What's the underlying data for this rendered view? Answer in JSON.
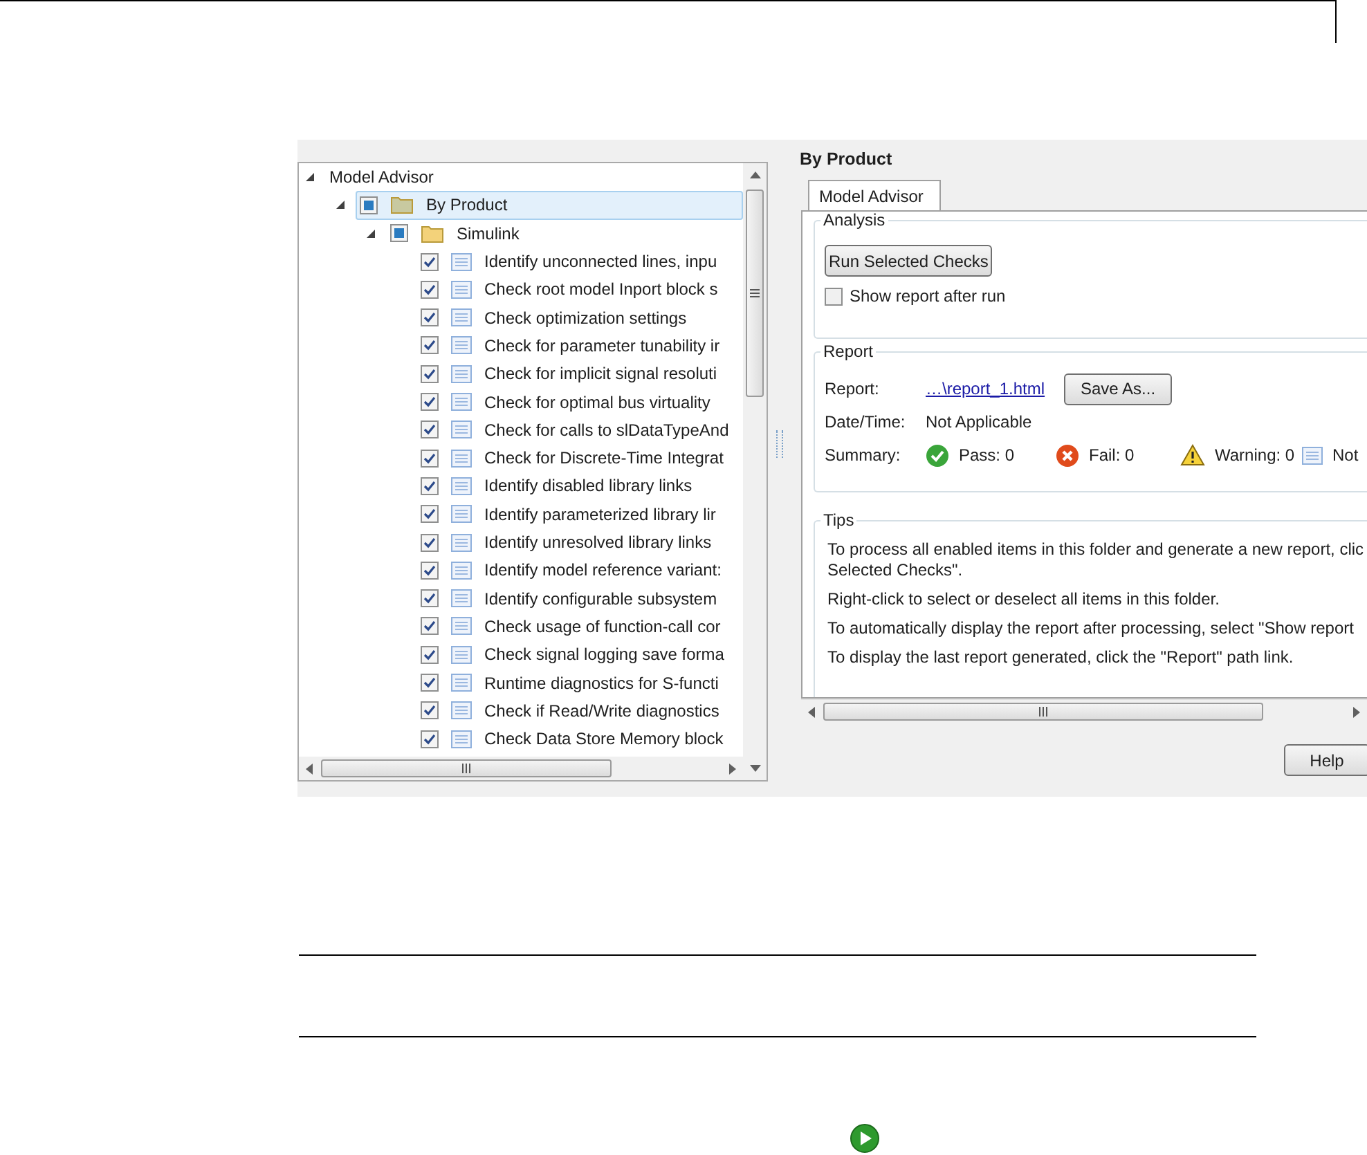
{
  "tree": {
    "label": "Model Advisor",
    "expanded": true,
    "children": [
      {
        "label": "By Product",
        "kind": "folder",
        "checked": false,
        "indeterminate": true,
        "selected": true,
        "expanded": true,
        "children": [
          {
            "label": "Simulink",
            "kind": "folder",
            "checked": false,
            "indeterminate": true,
            "selected": false,
            "expanded": true,
            "children": [
              {
                "label": "Identify unconnected lines, inpu",
                "kind": "check",
                "checked": true,
                "indeterminate": false,
                "selected": false
              },
              {
                "label": "Check root model Inport block s",
                "kind": "check",
                "checked": true,
                "indeterminate": false,
                "selected": false
              },
              {
                "label": "Check optimization settings",
                "kind": "check",
                "checked": true,
                "indeterminate": false,
                "selected": false
              },
              {
                "label": "Check for parameter tunability ir",
                "kind": "check",
                "checked": true,
                "indeterminate": false,
                "selected": false
              },
              {
                "label": "Check for implicit signal resoluti",
                "kind": "check",
                "checked": true,
                "indeterminate": false,
                "selected": false
              },
              {
                "label": "Check for optimal bus virtuality",
                "kind": "check",
                "checked": true,
                "indeterminate": false,
                "selected": false
              },
              {
                "label": "Check for calls to slDataTypeAnd",
                "kind": "check",
                "checked": true,
                "indeterminate": false,
                "selected": false
              },
              {
                "label": "Check for Discrete-Time Integrat",
                "kind": "check",
                "checked": true,
                "indeterminate": false,
                "selected": false
              },
              {
                "label": "Identify disabled library links",
                "kind": "check",
                "checked": true,
                "indeterminate": false,
                "selected": false
              },
              {
                "label": "Identify parameterized library lir",
                "kind": "check",
                "checked": true,
                "indeterminate": false,
                "selected": false
              },
              {
                "label": "Identify unresolved library links",
                "kind": "check",
                "checked": true,
                "indeterminate": false,
                "selected": false
              },
              {
                "label": "Identify model reference variant:",
                "kind": "check",
                "checked": true,
                "indeterminate": false,
                "selected": false
              },
              {
                "label": "Identify configurable subsystem",
                "kind": "check",
                "checked": true,
                "indeterminate": false,
                "selected": false
              },
              {
                "label": "Check usage of function-call cor",
                "kind": "check",
                "checked": true,
                "indeterminate": false,
                "selected": false
              },
              {
                "label": "Check signal logging save forma",
                "kind": "check",
                "checked": true,
                "indeterminate": false,
                "selected": false
              },
              {
                "label": "Runtime diagnostics for S-functi",
                "kind": "check",
                "checked": true,
                "indeterminate": false,
                "selected": false
              },
              {
                "label": "Check if Read/Write diagnostics",
                "kind": "check",
                "checked": true,
                "indeterminate": false,
                "selected": false
              },
              {
                "label": "Check Data Store Memory block",
                "kind": "check",
                "checked": true,
                "indeterminate": false,
                "selected": false
              }
            ]
          }
        ]
      }
    ]
  },
  "header": "By Product",
  "tabs": [
    {
      "label": "Model Advisor",
      "selected": true
    }
  ],
  "analysis": {
    "title": "Analysis",
    "run_button": "Run Selected Checks",
    "show_report": {
      "label": "Show report after run",
      "checked": false
    }
  },
  "report": {
    "title": "Report",
    "report_label": "Report:",
    "report_link": "…\\report_1.html",
    "save_button": "Save As...",
    "date_label": "Date/Time:",
    "date_value": "Not Applicable",
    "summary_label": "Summary:",
    "summary": [
      {
        "kind": "pass",
        "text": "Pass: 0"
      },
      {
        "kind": "fail",
        "text": "Fail: 0"
      },
      {
        "kind": "warning",
        "text": "Warning: 0"
      },
      {
        "kind": "not_run",
        "text": "Not"
      }
    ]
  },
  "tips": {
    "title": "Tips",
    "paragraphs": [
      [
        "To process all enabled items in this folder and generate a new report, clic",
        "Selected Checks\"."
      ],
      [
        "Right-click to select or deselect all items in this folder."
      ],
      [
        "To automatically display the report after processing, select \"Show report"
      ],
      [
        "To display the last report generated, click the \"Report\" path link."
      ]
    ]
  },
  "help_button": "Help"
}
